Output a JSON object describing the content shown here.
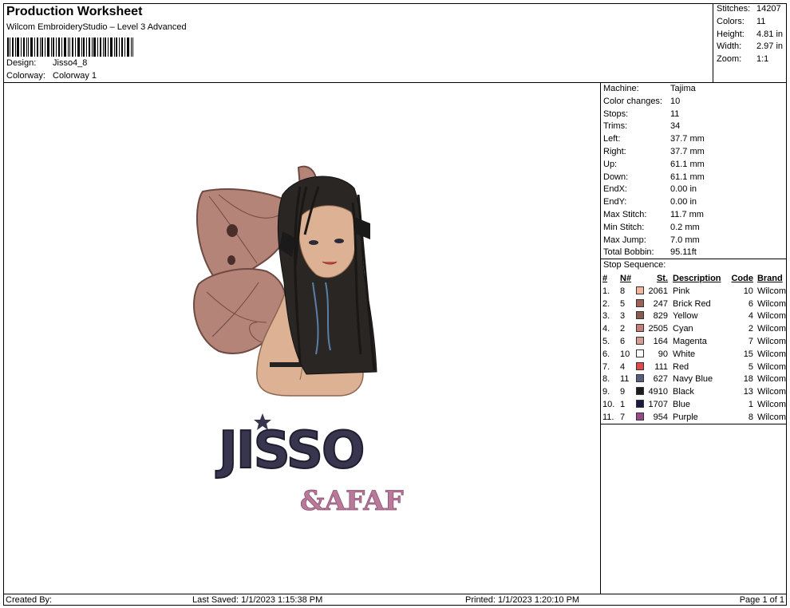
{
  "header": {
    "title": "Production Worksheet",
    "subtitle": "Wilcom EmbroideryStudio – Level 3 Advanced",
    "design_label": "Design:",
    "design_value": "Jisso4_8",
    "colorway_label": "Colorway:",
    "colorway_value": "Colorway 1"
  },
  "stats": [
    {
      "label": "Stitches:",
      "value": "14207"
    },
    {
      "label": "Colors:",
      "value": "11"
    },
    {
      "label": "Height:",
      "value": "4.81 in"
    },
    {
      "label": "Width:",
      "value": "2.97 in"
    },
    {
      "label": "Zoom:",
      "value": "1:1"
    }
  ],
  "machine_info": [
    {
      "label": "Machine:",
      "value": "Tajima"
    },
    {
      "label": "Color changes:",
      "value": "10"
    },
    {
      "label": "Stops:",
      "value": "11"
    },
    {
      "label": "Trims:",
      "value": "34"
    },
    {
      "label": "Left:",
      "value": "37.7 mm"
    },
    {
      "label": "Right:",
      "value": "37.7 mm"
    },
    {
      "label": "Up:",
      "value": "61.1 mm"
    },
    {
      "label": "Down:",
      "value": "61.1 mm"
    },
    {
      "label": "EndX:",
      "value": "0.00 in"
    },
    {
      "label": "EndY:",
      "value": "0.00 in"
    },
    {
      "label": "Max Stitch:",
      "value": "11.7 mm"
    },
    {
      "label": "Min Stitch:",
      "value": "0.2 mm"
    },
    {
      "label": "Max Jump:",
      "value": "7.0 mm"
    },
    {
      "label": "Total Bobbin:",
      "value": "95.11ft"
    }
  ],
  "stop_sequence": {
    "label": "Stop Sequence:",
    "headers": {
      "num": "#",
      "n": "N#",
      "st": "St.",
      "desc": "Description",
      "code": "Code",
      "brand": "Brand"
    },
    "rows": [
      {
        "num": "1.",
        "n": "8",
        "color": "#f2b69a",
        "st": "2061",
        "desc": "Pink",
        "code": "10",
        "brand": "Wilcom"
      },
      {
        "num": "2.",
        "n": "5",
        "color": "#9c6253",
        "st": "247",
        "desc": "Brick Red",
        "code": "6",
        "brand": "Wilcom"
      },
      {
        "num": "3.",
        "n": "3",
        "color": "#8a5a50",
        "st": "829",
        "desc": "Yellow",
        "code": "4",
        "brand": "Wilcom"
      },
      {
        "num": "4.",
        "n": "2",
        "color": "#c47d78",
        "st": "2505",
        "desc": "Cyan",
        "code": "2",
        "brand": "Wilcom"
      },
      {
        "num": "5.",
        "n": "6",
        "color": "#d49c94",
        "st": "164",
        "desc": "Magenta",
        "code": "7",
        "brand": "Wilcom"
      },
      {
        "num": "6.",
        "n": "10",
        "color": "#ffffff",
        "st": "90",
        "desc": "White",
        "code": "15",
        "brand": "Wilcom"
      },
      {
        "num": "7.",
        "n": "4",
        "color": "#e0494b",
        "st": "111",
        "desc": "Red",
        "code": "5",
        "brand": "Wilcom"
      },
      {
        "num": "8.",
        "n": "11",
        "color": "#56607e",
        "st": "627",
        "desc": "Navy Blue",
        "code": "18",
        "brand": "Wilcom"
      },
      {
        "num": "9.",
        "n": "9",
        "color": "#1c1c1c",
        "st": "4910",
        "desc": "Black",
        "code": "13",
        "brand": "Wilcom"
      },
      {
        "num": "10.",
        "n": "1",
        "color": "#1a1a40",
        "st": "1707",
        "desc": "Blue",
        "code": "1",
        "brand": "Wilcom"
      },
      {
        "num": "11.",
        "n": "7",
        "color": "#9a4a86",
        "st": "954",
        "desc": "Purple",
        "code": "8",
        "brand": "Wilcom"
      }
    ]
  },
  "design_text": {
    "main": "JISSO",
    "sub": "&AFAF"
  },
  "footer": {
    "created_by": "Created By:",
    "last_saved": "Last Saved: 1/1/2023 1:15:38 PM",
    "printed": "Printed: 1/1/2023 1:20:10 PM",
    "page": "Page 1 of 1"
  }
}
